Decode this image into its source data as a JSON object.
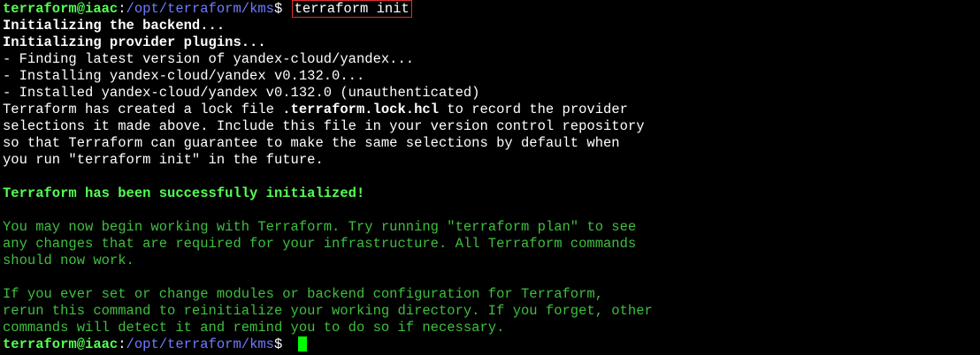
{
  "colors": {
    "background": "#000000",
    "prompt_user": "#55ff55",
    "prompt_path": "#6f7bff",
    "output_text": "#ffffff",
    "success_text": "#3fbf3f",
    "command_highlight_border": "#e03030",
    "cursor": "#00ff00"
  },
  "prompt1": {
    "user": "terraform@iaac",
    "sep": ":",
    "path": "/opt/terraform/kms",
    "symbol": "$ ",
    "command": "terraform init"
  },
  "output": {
    "init_backend": "Initializing the backend...",
    "init_plugins": "Initializing provider plugins...",
    "finding": "- Finding latest version of yandex-cloud/yandex...",
    "installing": "- Installing yandex-cloud/yandex v0.132.0...",
    "installed": "- Installed yandex-cloud/yandex v0.132.0 (unauthenticated)",
    "lock_pre": "Terraform has created a lock file ",
    "lock_file": ".terraform.lock.hcl",
    "lock_post": " to record the provider",
    "lock2": "selections it made above. Include this file in your version control repository",
    "lock3": "so that Terraform can guarantee to make the same selections by default when",
    "lock4": "you run \"terraform init\" in the future.",
    "success": "Terraform has been successfully initialized!",
    "begin1": "You may now begin working with Terraform. Try running \"terraform plan\" to see",
    "begin2": "any changes that are required for your infrastructure. All Terraform commands",
    "begin3": "should now work.",
    "modules1": "If you ever set or change modules or backend configuration for Terraform,",
    "modules2": "rerun this command to reinitialize your working directory. If you forget, other",
    "modules3": "commands will detect it and remind you to do so if necessary."
  },
  "prompt2": {
    "user": "terraform@iaac",
    "sep": ":",
    "path": "/opt/terraform/kms",
    "symbol": "$ "
  }
}
